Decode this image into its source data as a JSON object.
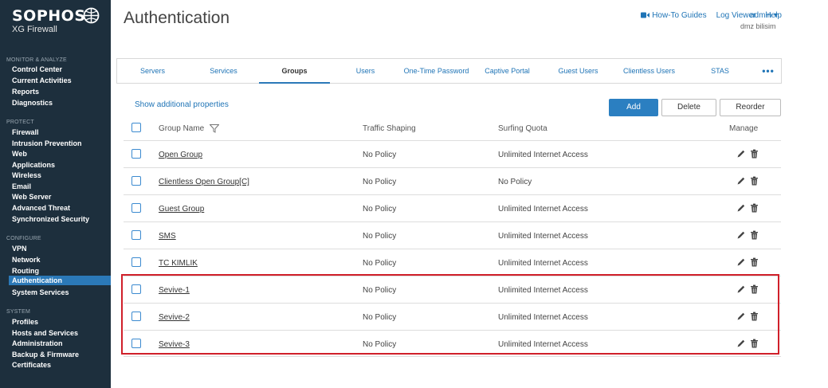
{
  "brand": {
    "name": "SOPHOS",
    "product": "XG Firewall"
  },
  "sidebar": {
    "sections": [
      {
        "label": "MONITOR & ANALYZE",
        "items": [
          "Control Center",
          "Current Activities",
          "Reports",
          "Diagnostics"
        ]
      },
      {
        "label": "PROTECT",
        "items": [
          "Firewall",
          "Intrusion Prevention",
          "Web",
          "Applications",
          "Wireless",
          "Email",
          "Web Server",
          "Advanced Threat",
          "Synchronized Security"
        ]
      },
      {
        "label": "CONFIGURE",
        "items": [
          "VPN",
          "Network",
          "Routing",
          "Authentication",
          "System Services"
        ]
      },
      {
        "label": "SYSTEM",
        "items": [
          "Profiles",
          "Hosts and Services",
          "Administration",
          "Backup & Firmware",
          "Certificates"
        ]
      }
    ],
    "active_item": "Authentication"
  },
  "header": {
    "title": "Authentication",
    "links": {
      "howto": "How-To Guides",
      "logviewer": "Log Viewer",
      "help": "Help"
    },
    "user": "admin ▾",
    "tenant": "dmz bilisim"
  },
  "tabs": [
    "Servers",
    "Services",
    "Groups",
    "Users",
    "One-Time Password",
    "Captive Portal",
    "Guest Users",
    "Clientless Users",
    "STAS",
    "•••"
  ],
  "active_tab": "Groups",
  "toolbar": {
    "show_props": "Show additional properties",
    "add": "Add",
    "delete": "Delete",
    "reorder": "Reorder"
  },
  "table": {
    "columns": {
      "name": "Group Name",
      "traffic": "Traffic Shaping",
      "quota": "Surfing Quota",
      "manage": "Manage"
    },
    "rows": [
      {
        "name": "Open Group",
        "traffic": "No Policy",
        "quota": "Unlimited Internet Access"
      },
      {
        "name": "Clientless Open Group[C]",
        "traffic": "No Policy",
        "quota": "No Policy"
      },
      {
        "name": "Guest Group",
        "traffic": "No Policy",
        "quota": "Unlimited Internet Access"
      },
      {
        "name": "SMS",
        "traffic": "No Policy",
        "quota": "Unlimited Internet Access"
      },
      {
        "name": "TC KIMLIK",
        "traffic": "No Policy",
        "quota": "Unlimited Internet Access"
      },
      {
        "name": "Sevive-1",
        "traffic": "No Policy",
        "quota": "Unlimited Internet Access"
      },
      {
        "name": "Sevive-2",
        "traffic": "No Policy",
        "quota": "Unlimited Internet Access"
      },
      {
        "name": "Sevive-3",
        "traffic": "No Policy",
        "quota": "Unlimited Internet Access"
      }
    ]
  },
  "colors": {
    "sidebar_bg": "#1d2f3d",
    "accent": "#2b79b8",
    "link": "#1f74b6",
    "highlight": "#d0202a"
  }
}
